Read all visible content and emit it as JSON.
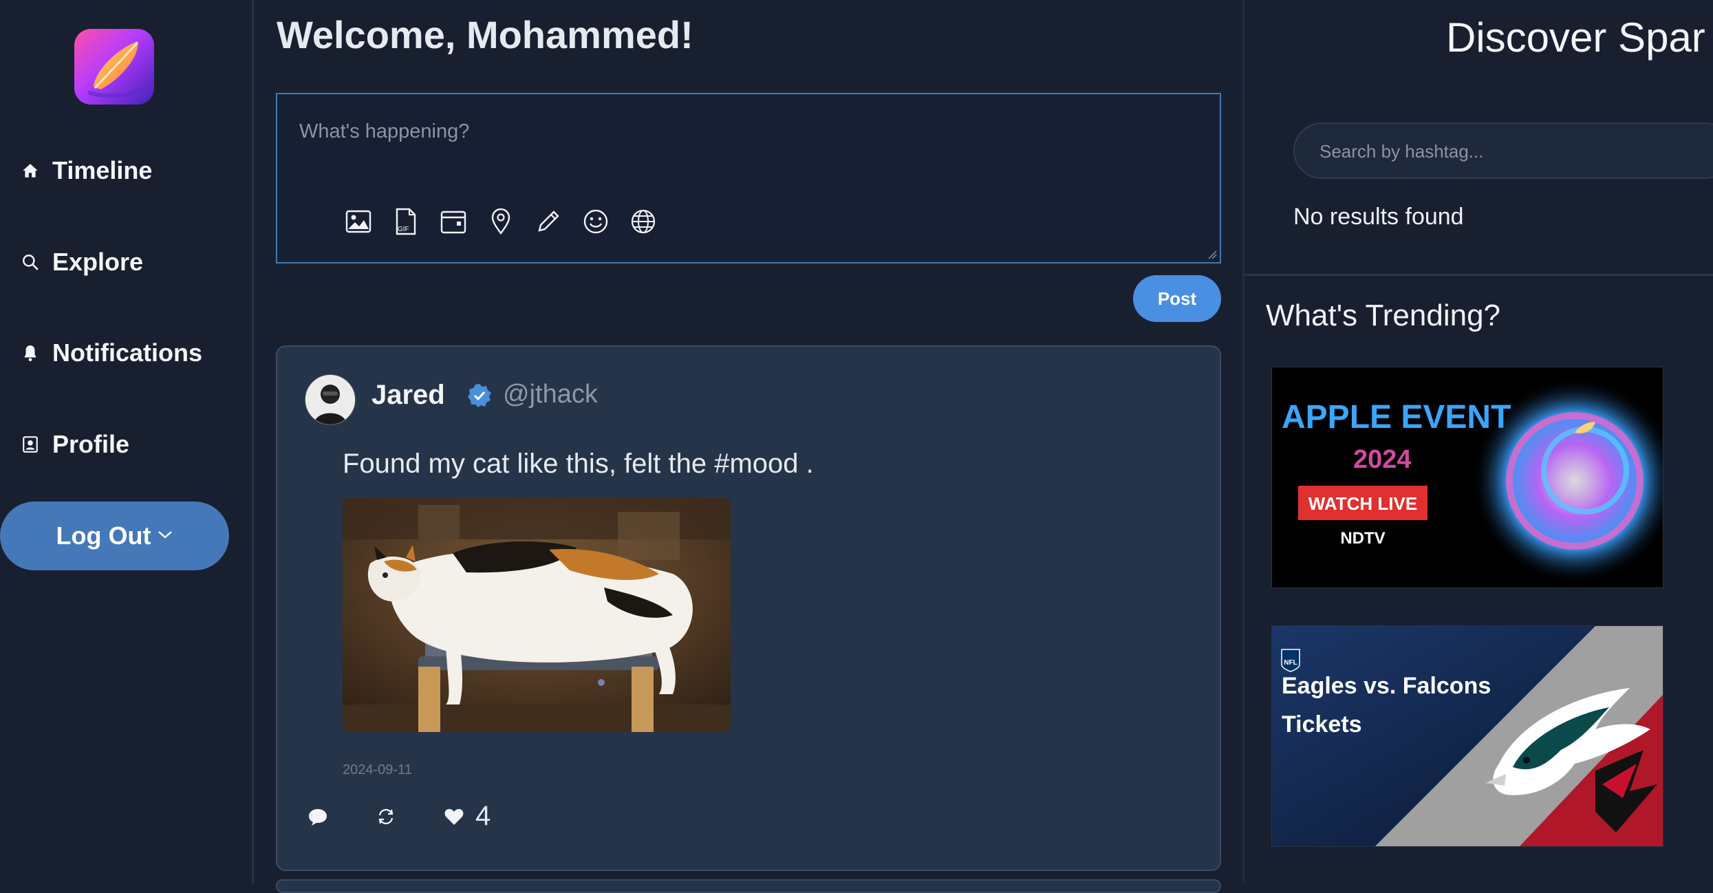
{
  "sidebar": {
    "items": [
      {
        "label": "Timeline",
        "icon": "home-icon"
      },
      {
        "label": "Explore",
        "icon": "search-icon"
      },
      {
        "label": "Notifications",
        "icon": "bell-icon"
      },
      {
        "label": "Profile",
        "icon": "profile-icon"
      }
    ],
    "logout_label": "Log Out"
  },
  "main": {
    "welcome": "Welcome, Mohammed!",
    "composer": {
      "placeholder": "What's happening?",
      "tools": [
        "image-icon",
        "gif-icon",
        "calendar-icon",
        "location-icon",
        "pencil-icon",
        "emoji-icon",
        "globe-icon"
      ],
      "gif_text": "GIF"
    },
    "post_button": "Post",
    "post": {
      "author": "Jared",
      "handle": "@jthack",
      "text": "Found my cat like this, felt the #mood .",
      "date": "2024-09-11",
      "likes": "4"
    }
  },
  "right": {
    "title": "Discover Spar",
    "search_placeholder": "Search by hashtag...",
    "no_results": "No results found",
    "trending_title": "What's Trending?",
    "trends": [
      {
        "line1": "APPLE EVENT",
        "line2": "2024",
        "badge": "WATCH LIVE",
        "brand": "NDTV"
      },
      {
        "badge": "NFL",
        "line1": "Eagles vs. Falcons",
        "line2": "Tickets"
      }
    ]
  },
  "colors": {
    "background": "#182030",
    "accent": "#4a90e2",
    "logout": "#4578b8",
    "card": "#26344a"
  }
}
